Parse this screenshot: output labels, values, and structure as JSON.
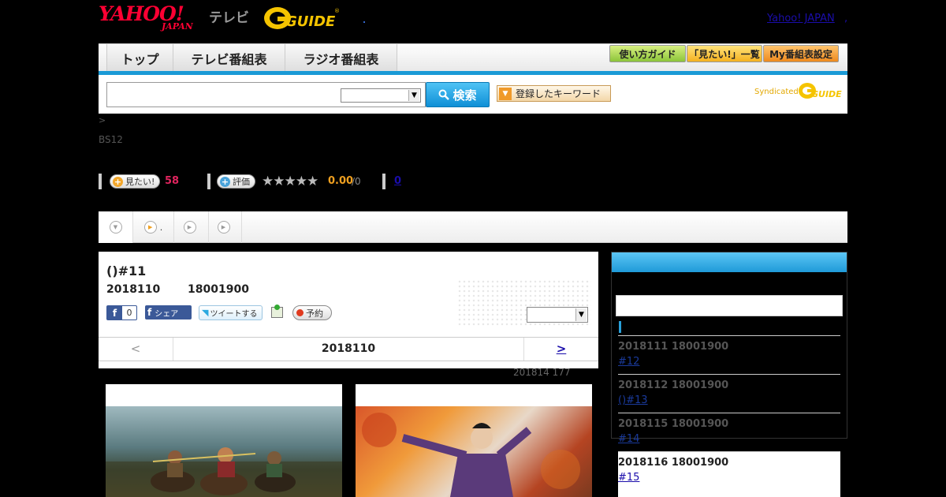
{
  "header": {
    "logo_yahoo": "YAHOO!",
    "logo_japan": "JAPAN",
    "logo_tv": "テレビ",
    "logo_gguide": "G-GUIDE",
    "yahoo_japan_link": "Yahoo! JAPAN",
    "link_sep": ","
  },
  "nav": {
    "tabs": [
      "トップ",
      "テレビ番組表",
      "ラジオ番組表"
    ],
    "buttons": [
      "使い方ガイド",
      "「見たい!」一覧",
      "My番組表設定"
    ]
  },
  "search": {
    "input_value": "",
    "select_value": "",
    "button_label": "検索",
    "keyword_button": "登録したキーワード",
    "syndicated": "Syndicated"
  },
  "breadcrumb": ">",
  "channel": "BS12",
  "stats": {
    "want_label": "見たい!",
    "want_count": "58",
    "rate_label": "評価",
    "stars": "★★★★★",
    "score": "0.00",
    "score_of": "/0",
    "review_count": "0"
  },
  "tabs": [
    ".",
    "",
    ""
  ],
  "program": {
    "title": "()#11",
    "date": "2018110",
    "time": "18001900",
    "fb_like_count": "0",
    "fb_share": "シェア",
    "tweet": "ツイートする",
    "reserve": "予約",
    "select_value": ""
  },
  "pager": {
    "prev": "<",
    "current": "2018110",
    "next": ">"
  },
  "update_note": "201814  177",
  "episodes": [
    {
      "date": "2018111  18001900",
      "title": "#12"
    },
    {
      "date": "2018112  18001900",
      "title": "()#13"
    },
    {
      "date": "2018115  18001900",
      "title": "#14"
    },
    {
      "date": "2018116  18001900",
      "title": "#15"
    }
  ],
  "colors": {
    "accent_blue": "#1a9ad6",
    "want_count": "#e0245e",
    "score": "#f0a020",
    "link": "#1a0dab"
  }
}
